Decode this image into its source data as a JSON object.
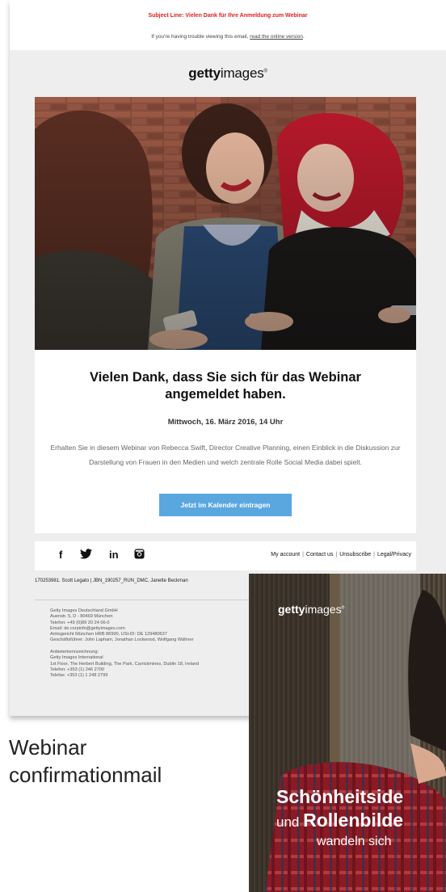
{
  "email": {
    "subject_line": "Subject Line: Vielen Dank für Ihre Anmeldung zum Webinar",
    "trouble_text": "If you're having trouble viewing this email, ",
    "trouble_link": "read the online version",
    "trouble_end": ".",
    "logo_bold": "getty",
    "logo_light": "images",
    "logo_mark": "®",
    "headline": "Vielen Dank, dass Sie sich für das Webinar angemeldet haben.",
    "date": "Mittwoch, 16. März 2016, 14 Uhr",
    "description": "Erhalten Sie in diesem Webinar von Rebecca Swift, Director Creative Planning, einen Einblick in die Diskussion zur Darstellung von Frauen in den Medien und welch zentrale Rolle Social Media dabei spielt.",
    "cta_label": "Jetzt im Kalender eintragen",
    "social": {
      "facebook": "f",
      "twitter": "🐦",
      "linkedin": "in",
      "instagram": "◙"
    },
    "footer_links": [
      "My account",
      "Contact us",
      "Unsubscribe",
      "Legal/Privacy"
    ],
    "meta_row": "170253981. Scott Legato  |  JBN_190257_RUN_DMC, Janette Beckman",
    "address": "Getty Images Deutschland GmbH\nAuenstr. 5, D - 80469 München\nTelefon: +49 (0)89 20 24 06-0\nEmail: de.corpinfo@gettyimages.com\nAmtsgericht München HRB 86990, USt-ID: DE 129480637\nGeschäftsführer: John Lapham, Jonathan Lockwood, Wolfgang Wähner\n\nAnbieterkennzeichnung:\nGetty Images International\n1st Floor, The Herbert Building, The Park, Carrickmines, Dublin 18, Ireland\nTelefon: +353 (1) 246 2700\nTelefax: +353 (1) 1 248 2799"
  },
  "caption": {
    "line1": "Webinar",
    "line2": "confirmationmail"
  },
  "poster": {
    "logo_bold": "getty",
    "logo_light": "images",
    "logo_mark": "®",
    "title_line1": "Schönheitside",
    "title_und": "und ",
    "title_line2": "Rollenbilde",
    "title_line3": "wandeln sich"
  }
}
